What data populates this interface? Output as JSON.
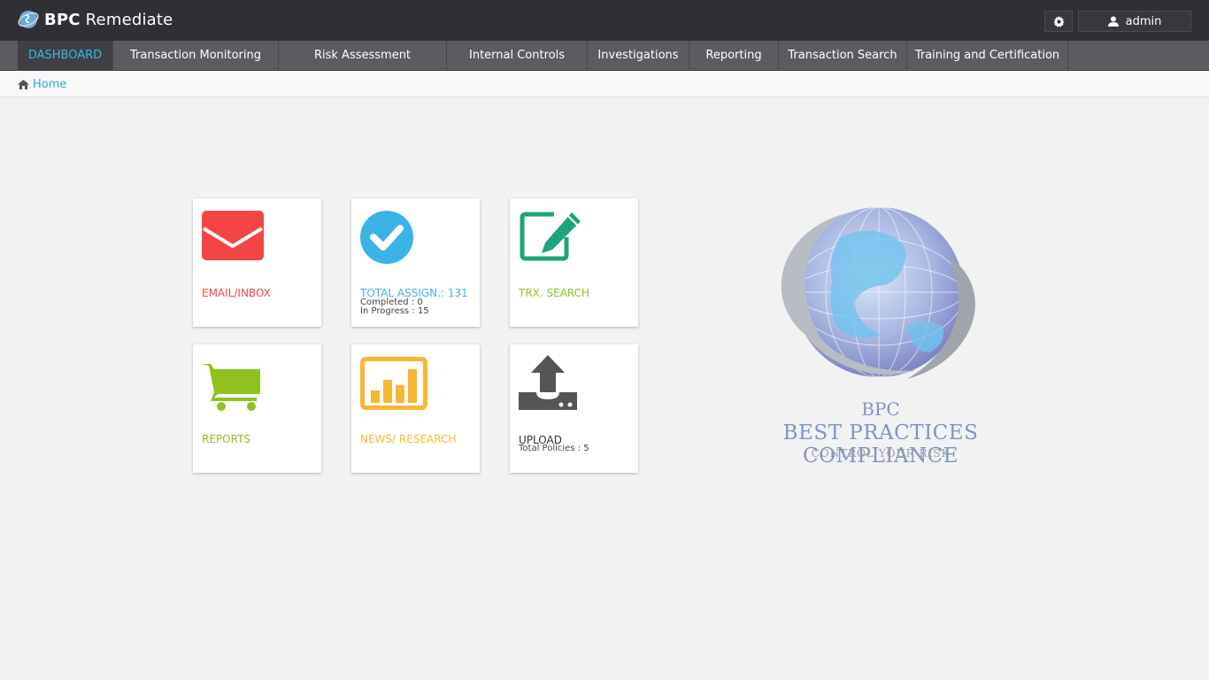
{
  "app": {
    "name_bold": "BPC",
    "name_rest": " Remediate",
    "logo_icon": "globe-icon"
  },
  "top_right": {
    "settings_icon": "gear-icon",
    "user_icon": "user-icon",
    "user_label": "admin"
  },
  "nav": {
    "items": [
      {
        "label": "DASHBOARD",
        "active": true
      },
      {
        "label": "Transaction Monitoring"
      },
      {
        "label": "Risk Assessment"
      },
      {
        "label": "Internal Controls"
      },
      {
        "label": "Investigations"
      },
      {
        "label": "Reporting"
      },
      {
        "label": "Transaction Search"
      },
      {
        "label": "Training and Certification"
      }
    ]
  },
  "breadcrumb": {
    "icon": "home-icon",
    "label": "Home"
  },
  "tiles": {
    "email": {
      "label": "EMAIL/INBOX",
      "icon": "envelope-icon",
      "color": "#f44545"
    },
    "assign": {
      "label": "TOTAL ASSIGN.: 131",
      "completed": "Completed : 0",
      "in_progress": "In Progress : 15",
      "icon": "check-circle-icon",
      "color": "#3ab3e6"
    },
    "trx": {
      "label": "TRX. SEARCH",
      "icon": "edit-icon",
      "color": "#1fa37e",
      "label_color": "#8dc21f"
    },
    "reports": {
      "label": "REPORTS",
      "icon": "cart-icon",
      "color": "#8dc21f"
    },
    "news": {
      "label": "NEWS/ RESEARCH",
      "icon": "bar-chart-icon",
      "color": "#f7b731"
    },
    "upload": {
      "label": "UPLOAD",
      "total": "Total Policies : 5",
      "icon": "upload-icon",
      "color": "#555555"
    }
  },
  "logo": {
    "line1": "BPC",
    "line2": "BEST PRACTICES COMPLIANCE",
    "line3": "CONTROL YOUR RISK"
  }
}
